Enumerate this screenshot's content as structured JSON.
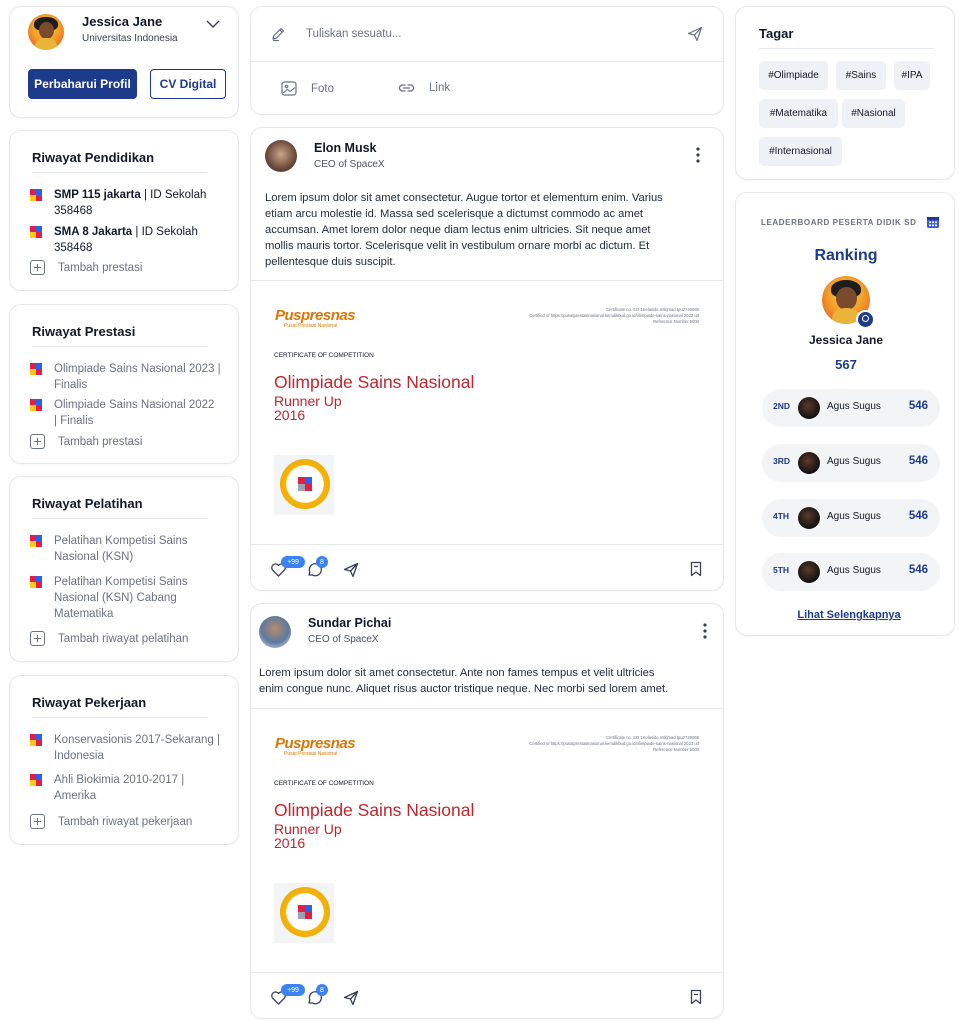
{
  "profile": {
    "name": "Jessica Jane",
    "school": "Universitas Indonesia",
    "update_button": "Perbaharui Profil",
    "cv_button": "CV Digital"
  },
  "education": {
    "title": "Riwayat Pendidikan",
    "items": [
      {
        "bold": "SMP 115 jakarta",
        "rest": " | ID Sekolah",
        "line2": "358468"
      },
      {
        "bold": "SMA 8 Jakarta",
        "rest": " | ID Sekolah",
        "line2": "358468"
      }
    ],
    "add": "Tambah prestasi"
  },
  "achievements": {
    "title": "Riwayat Prestasi",
    "items": [
      {
        "line1": "Olimpiade Sains Nasional 2023  |",
        "line2": "Finalis"
      },
      {
        "line1": "Olimpiade Sains Nasional 2022",
        "line2": "|  Finalis"
      }
    ],
    "add": "Tambah prestasi"
  },
  "training": {
    "title": "Riwayat Pelatihan",
    "items": [
      {
        "line1": "Pelatihan Kompetisi Sains",
        "line2": "Nasional (KSN)",
        "line3": ""
      },
      {
        "line1": "Pelatihan Kompetisi Sains",
        "line2": "Nasional (KSN) Cabang",
        "line3": "Matematika"
      }
    ],
    "add": "Tambah riwayat pelatihan"
  },
  "work": {
    "title": "Riwayat Pekerjaan",
    "items": [
      {
        "line1": "Konservasionis 2017-Sekarang  |",
        "line2": "Indonesia"
      },
      {
        "line1": "Ahli Biokimia 2010-2017  |",
        "line2": "Amerika"
      }
    ],
    "add": "Tambah riwayat pekerjaan"
  },
  "composer": {
    "placeholder": "Tuliskan sesuatu...",
    "photo": "Foto",
    "link": "Link"
  },
  "posts": [
    {
      "author": "Elon Musk",
      "role": "CEO of SpaceX",
      "body_lines": [
        "Lorem ipsum dolor sit amet consectetur. Augue tortor et elementum enim. Varius",
        "etiam arcu molestie id. Massa sed scelerisque a dictumst commodo ac amet",
        "accumsan. Amet lorem dolor neque diam lectus enim ultricies. Sit neque amet",
        "mollis mauris tortor. Scelerisque velit in vestibulum ornare morbi ac dictum. Et",
        "pellentesque duis suscipit."
      ],
      "cert": {
        "brand": "Puspresnas",
        "brand_sub": "Pusat Prestasi Nasional",
        "meta1": "Certificate no. SO 1Kelaside.mtkjmad.tpu2726066",
        "meta2": "Certified of https://pusatprestasinasional.kemdikbud.go.id/olimpiade-sains-nasional 2023 ud",
        "meta3": "Reference Number 5000",
        "kind": "CERTIFICATE OF COMPETITION",
        "title": "Olimpiade Sains Nasional",
        "rank": "Runner Up",
        "year": "2016"
      },
      "likes_badge": "+99",
      "comments_badge": "8"
    },
    {
      "author": "Sundar Pichai",
      "role": "CEO of SpaceX",
      "body_lines": [
        "Lorem ipsum dolor sit amet consectetur. Ante non fames tempus et velit ultricies",
        "enim congue nunc. Aliquet risus auctor tristique neque. Nec morbi sed lorem amet."
      ],
      "cert": {
        "brand": "Puspresnas",
        "brand_sub": "Pusat Prestasi Nasional",
        "meta1": "Certificate no. SO 1Kelaside.mtkjmad.tpu2726066",
        "meta2": "Certified of https://pusatprestasinasional.kemdikbud.go.id/olimpiade-sains-nasional 2023 ud",
        "meta3": "Reference Number 5000",
        "kind": "CERTIFICATE OF COMPETITION",
        "title": "Olimpiade Sains Nasional",
        "rank": "Runner Up",
        "year": "2016"
      },
      "likes_badge": "+99",
      "comments_badge": "8"
    }
  ],
  "tags": {
    "title": "Tagar",
    "items": [
      "#Olimpiade",
      "#Sains",
      "#IPA",
      "#Matematika",
      "#Nasional",
      "#Internasional"
    ]
  },
  "leaderboard": {
    "title": "LEADERBOARD PESERTA DIDIK SD",
    "ranking_label": "Ranking",
    "top_name": "Jessica Jane",
    "top_score": "567",
    "rows": [
      {
        "pos": "2ND",
        "name": "Agus Sugus",
        "score": "546"
      },
      {
        "pos": "3RD",
        "name": "Agus Sugus",
        "score": "546"
      },
      {
        "pos": "4TH",
        "name": "Agus Sugus",
        "score": "546"
      },
      {
        "pos": "5TH",
        "name": "Agus Sugus",
        "score": "546"
      }
    ],
    "see_more": "Lihat Selengkapnya"
  },
  "colors": {
    "primary": "#1e3a8a",
    "accent_red": "#c0262d",
    "brand_orange": "#d97706",
    "badge_blue": "#3b82f6"
  }
}
